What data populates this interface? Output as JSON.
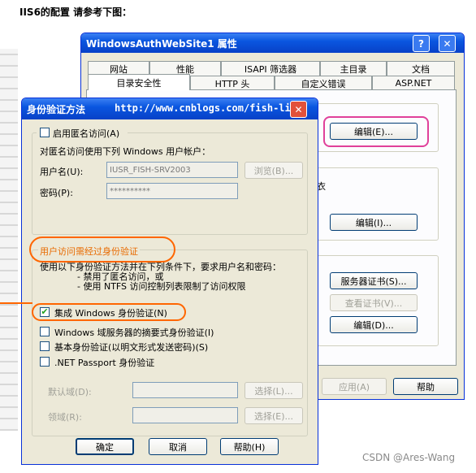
{
  "caption": "IIS6的配置 请参考下图：",
  "back_window": {
    "title": "WindowsAuthWebSite1 属性",
    "help_btn": "?",
    "close_btn": "✕",
    "tabs_row1": [
      "网站",
      "性能",
      "ISAPI 筛选器",
      "主目录",
      "文档"
    ],
    "tabs_row2": [
      "目录安全性",
      "HTTP 头",
      "自定义错误",
      "ASP.NET"
    ],
    "edit1": "编辑(E)...",
    "edit2": "编辑(I)...",
    "server_cert": "服务器证书(S)...",
    "view_cert": "查看证书(V)...",
    "edit3": "编辑(D)...",
    "apply": "应用(A)",
    "help": "帮助",
    "partial_text": "衣"
  },
  "front_window": {
    "title": "身份验证方法",
    "url": "http://www.cnblogs.com/fish-li/",
    "close_btn": "✕",
    "anon_checkbox_label": "启用匿名访问(A)",
    "anon_desc": "对匿名访问使用下列 Windows 用户帐户：",
    "username_label": "用户名(U):",
    "username_value": "IUSR_FISH-SRV2003",
    "browse_btn": "浏览(B)...",
    "password_label": "密码(P):",
    "password_value": "**********",
    "auth_group_title": "用户访问需经过身份验证",
    "auth_desc1": "使用以下身份验证方法并在下列条件下，要求用户名和密码：",
    "auth_desc2": "- 禁用了匿名访问，或",
    "auth_desc3": "- 使用 NTFS 访问控制列表限制了访问权限",
    "opt_integrated": "集成 Windows 身份验证(N)",
    "opt_digest": "Windows 域服务器的摘要式身份验证(I)",
    "opt_basic": "基本身份验证(以明文形式发送密码)(S)",
    "opt_passport": ".NET Passport 身份验证",
    "default_domain_label": "默认域(D):",
    "select_btn1": "选择(L)...",
    "realm_label": "领域(R):",
    "select_btn2": "选择(E)...",
    "ok": "确定",
    "cancel": "取消",
    "help": "帮助(H)",
    "check_mark": "✔"
  },
  "watermark": "CSDN @Ares-Wang",
  "colors": {
    "titlebar": "#0a56e0",
    "annotation": "#ff6600",
    "highlight": "#e0409a",
    "window_bg": "#ece9d8"
  }
}
